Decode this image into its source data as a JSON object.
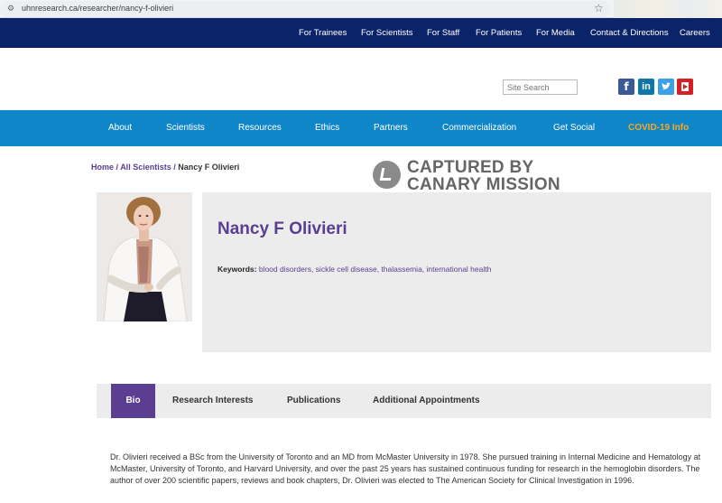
{
  "browser": {
    "url": "uhnresearch.ca/researcher/nancy-f-olivieri"
  },
  "topnav": {
    "items": [
      "For Trainees",
      "For Scientists",
      "For Staff",
      "For Patients",
      "For Media",
      "Contact & Directions",
      "Careers"
    ]
  },
  "header": {
    "search_placeholder": "Site Search",
    "social": [
      "facebook-icon",
      "linkedin-icon",
      "twitter-icon",
      "youtube-icon"
    ]
  },
  "mainnav": {
    "items": [
      "About",
      "Scientists",
      "Resources",
      "Ethics",
      "Partners",
      "Commercialization",
      "Get Social",
      "COVID-19 Info"
    ]
  },
  "breadcrumb": {
    "home": "Home",
    "sep1": " / ",
    "section": "All Scientists",
    "sep2": " / ",
    "current": "Nancy F Olivieri"
  },
  "watermark": {
    "line1": "CAPTURED BY",
    "line2": "CANARY MISSION"
  },
  "profile": {
    "name": "Nancy F Olivieri",
    "keywords_label": "Keywords:",
    "keywords": "blood disorders, sickle cell disease, thalassemia, international health"
  },
  "tabs": [
    "Bio",
    "Research Interests",
    "Publications",
    "Additional Appointments"
  ],
  "bio": {
    "text": "Dr. Olivieri received a BSc from the University of Toronto and an MD from McMaster University in 1978. She pursued training in Internal Medicine and Hematology at McMaster, University of Toronto, and Harvard University, and over the past 25 years has sustained continuous funding for research in the hemoglobin disorders. The author of over 200 scientific papers, reviews and book chapters, Dr. Olivieri was elected to The American Society for Clinical Investigation in 1996."
  },
  "colors": {
    "topnav_bg": "#0b2469",
    "mainnav_bg": "#0f86c7",
    "accent_purple": "#5b3d91",
    "covid_orange": "#f7a823"
  }
}
